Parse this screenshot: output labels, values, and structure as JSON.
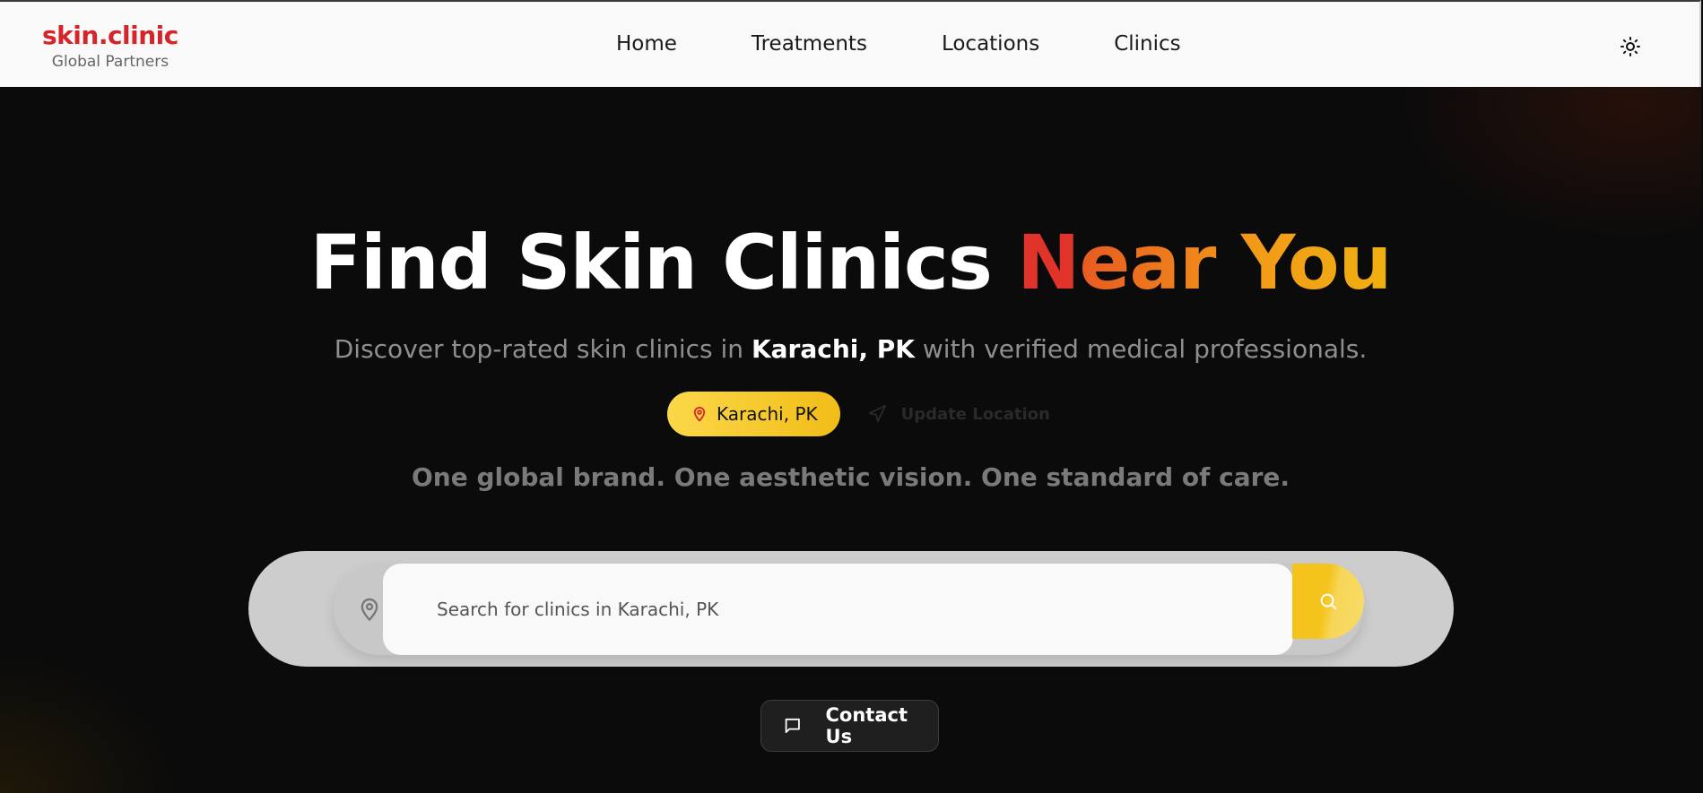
{
  "brand": {
    "name": "skin.clinic",
    "tagline": "Global Partners",
    "accent_color": "#d4262a"
  },
  "nav": {
    "items": [
      {
        "label": "Home"
      },
      {
        "label": "Treatments"
      },
      {
        "label": "Locations"
      },
      {
        "label": "Clinics"
      }
    ],
    "theme_toggle_icon": "sun-icon"
  },
  "hero": {
    "headline_part1": "Find Skin Clinics ",
    "headline_accent1": "N",
    "headline_accent2": "ear You",
    "subtitle_prefix": "Discover top-rated skin clinics in ",
    "subtitle_location": "Karachi, PK",
    "subtitle_suffix": " with verified medical professionals.",
    "location_pill": "Karachi, PK",
    "update_location": "Update Location",
    "tagline": "One global brand. One aesthetic vision. One standard of care.",
    "pill_color": "#f5c62a"
  },
  "search": {
    "placeholder": "Search for clinics in Karachi, PK",
    "value": "",
    "pin_icon": "map-pin-icon",
    "button_icon": "search-icon"
  },
  "contact": {
    "label": "Contact Us",
    "icon": "message-icon"
  }
}
